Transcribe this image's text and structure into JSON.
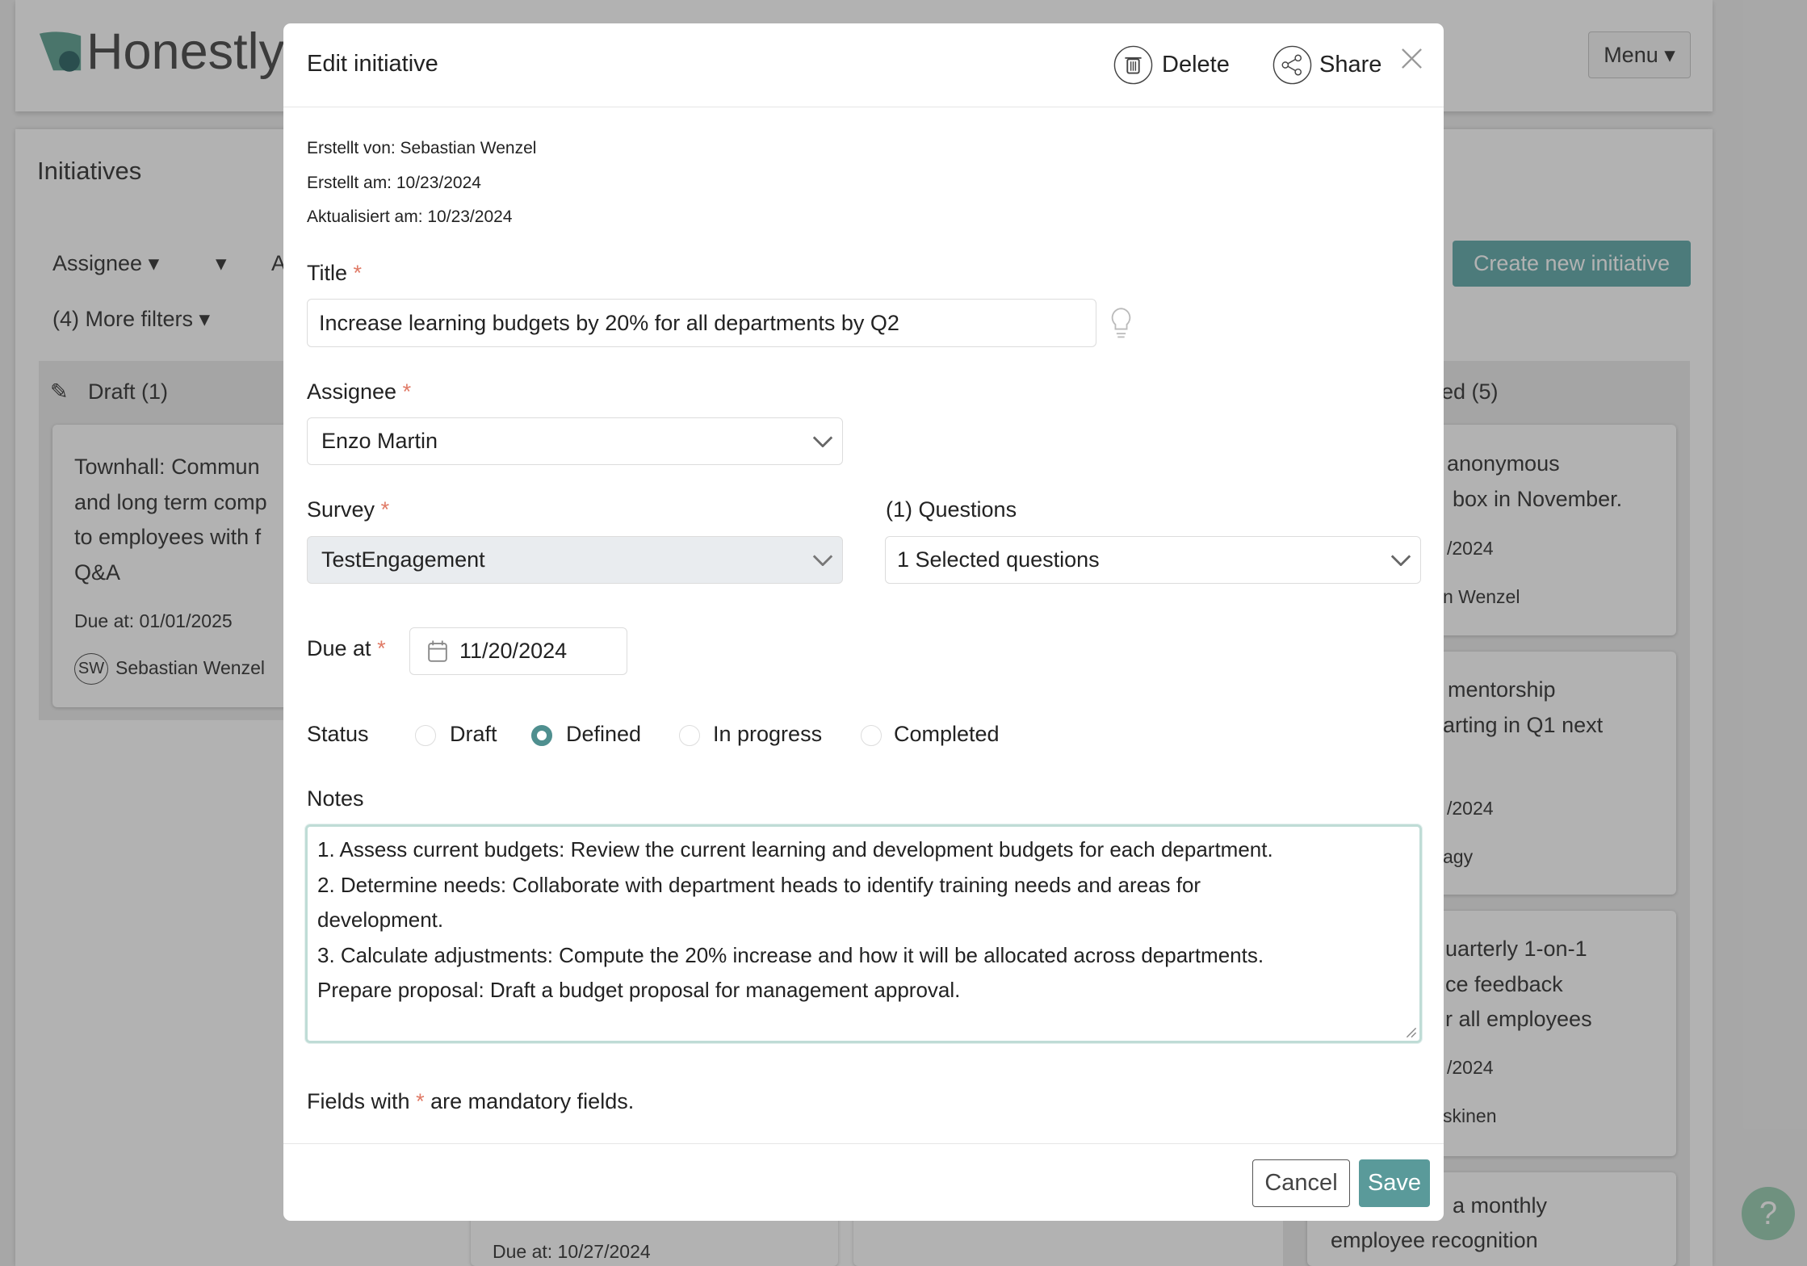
{
  "app": {
    "logo": "Honestly",
    "menu_label": "Menu"
  },
  "page": {
    "title": "Initiatives",
    "filters": {
      "assignee": "Assignee",
      "more_filters": "(4) More filters",
      "partial": "A"
    },
    "create_button": "Create new initiative",
    "draft_column": {
      "header": "Draft (1)",
      "card": {
        "title_lines": [
          "Townhall: Commun",
          "and long term comp",
          "to employees with f",
          "Q&A"
        ],
        "due": "Due at: 01/01/2025",
        "avatar": "SW",
        "owner": "Sebastian Wenzel"
      }
    },
    "second_column": {
      "card_due": "Due at: 10/27/2024"
    },
    "right_column": {
      "header": "ed (5)",
      "cards": [
        {
          "lines": [
            "anonymous",
            "box in November."
          ],
          "due": "/2024",
          "owner": "n Wenzel"
        },
        {
          "lines": [
            "mentorship",
            "arting in Q1 next"
          ],
          "due": "/2024",
          "owner": "agy"
        },
        {
          "lines": [
            "uarterly 1-on-1",
            "ce feedback",
            "r all employees"
          ],
          "due": "/2024",
          "owner": "skinen"
        },
        {
          "lines": [
            "a monthly",
            "employee recognition"
          ]
        }
      ]
    }
  },
  "modal": {
    "title": "Edit initiative",
    "delete_label": "Delete",
    "share_label": "Share",
    "meta": [
      "Erstellt von: Sebastian Wenzel",
      "Erstellt am: 10/23/2024",
      "Aktualisiert am: 10/23/2024"
    ],
    "title_label": "Title",
    "title_value": "Increase learning budgets by 20% for all departments by Q2",
    "assignee_label": "Assignee",
    "assignee_value": "Enzo Martin",
    "survey_label": "Survey",
    "survey_value": "TestEngagement",
    "questions_label": "(1) Questions",
    "questions_value": "1 Selected questions",
    "due_label": "Due at",
    "due_value": "11/20/2024",
    "status_label": "Status",
    "status_options": [
      "Draft",
      "Defined",
      "In progress",
      "Completed"
    ],
    "status_selected": "Defined",
    "notes_label": "Notes",
    "notes_lines": [
      "1. Assess current budgets: Review the current learning and development budgets for each department.",
      "2. Determine needs: Collaborate with department heads to identify training needs and areas for",
      "development.",
      "3. Calculate adjustments: Compute the 20% increase and how it will be allocated across departments.",
      "Prepare proposal: Draft a budget proposal for management approval."
    ],
    "mandatory_prefix": "Fields with",
    "mandatory_suffix": "are mandatory fields.",
    "required_mark": "*",
    "cancel_label": "Cancel",
    "save_label": "Save"
  },
  "help": "?",
  "colors": {
    "accent": "#5a9a9a",
    "required": "#e07a66"
  }
}
